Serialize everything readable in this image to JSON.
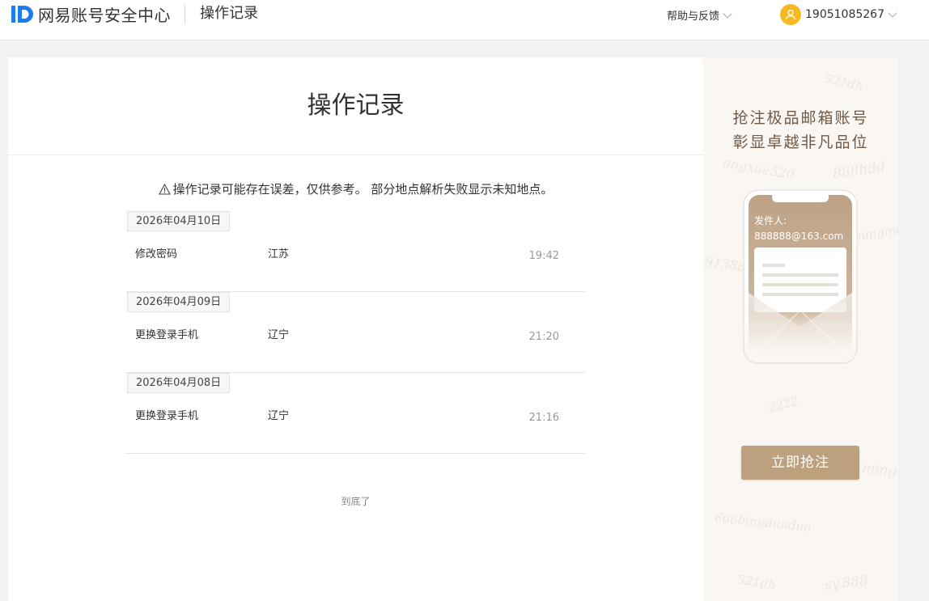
{
  "header": {
    "logo_text": "网易账号安全中心",
    "section_title": "操作记录",
    "help_label": "帮助与反馈",
    "user_phone": "19051085267"
  },
  "main": {
    "title": "操作记录",
    "notice": "操作记录可能存在误差，仅供参考。 部分地点解析失败显示未知地点。",
    "groups": [
      {
        "date": "2026年04月10日",
        "operation": "修改密码",
        "location": "江苏",
        "time": "19:42"
      },
      {
        "date": "2026年04月09日",
        "operation": "更换登录手机",
        "location": "辽宁",
        "time": "21:20"
      },
      {
        "date": "2026年04月08日",
        "operation": "更换登录手机",
        "location": "辽宁",
        "time": "21:16"
      }
    ],
    "end_text": "到底了"
  },
  "ad": {
    "line1": "抢注极品邮箱账号",
    "line2": "彰显卓越非凡品位",
    "sender_label": "发件人:",
    "sender_email": "888888@163.com",
    "button_label": "立即抢注",
    "watermarks": [
      "521dh",
      "888hdd",
      "angxue520",
      "91388",
      "ningmeng",
      "2222",
      "ming",
      "666bingdundun",
      "521dh",
      "sy.888"
    ]
  },
  "colors": {
    "accent_logo": "#1d7bf3",
    "avatar": "#f5b922",
    "ad_button": "#bda07e",
    "ad_text": "#6f5a48"
  }
}
